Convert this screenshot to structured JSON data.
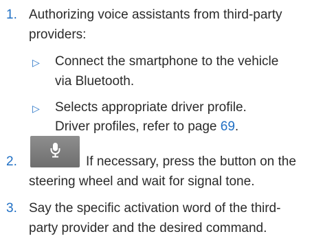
{
  "colors": {
    "accent": "#1f6fc4",
    "text": "#2a2a2a",
    "button_gray": "#7e7e7e"
  },
  "steps": [
    {
      "number": "1.",
      "lines": [
        "Authorizing voice assistants from third-party",
        "providers:"
      ],
      "substeps": [
        {
          "bullet": "▷",
          "lines": [
            "Connect the smartphone to the vehicle",
            "via Bluetooth."
          ]
        },
        {
          "bullet": "▷",
          "lines": [
            "Selects appropriate driver profile."
          ]
        }
      ],
      "reference": {
        "text": "Driver profiles, refer to page ",
        "page": "69",
        "suffix": "."
      }
    },
    {
      "number": "2.",
      "icon": "microphone-icon",
      "lines": [
        "If necessary, press the button on the",
        "steering wheel and wait for signal tone."
      ]
    },
    {
      "number": "3.",
      "lines": [
        "Say the specific activation word of the third-",
        "party provider and the desired command."
      ]
    }
  ]
}
